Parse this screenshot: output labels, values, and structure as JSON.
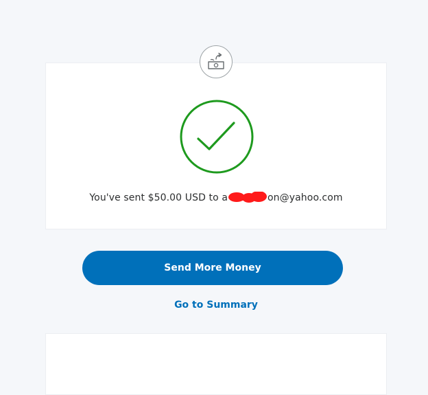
{
  "icons": {
    "badge": "money-send-icon",
    "status": "success-check-icon"
  },
  "colors": {
    "page_background": "#f5f7fa",
    "primary": "#0070ba",
    "success": "#1e9a1e",
    "redaction": "#ff1a1a"
  },
  "confirmation": {
    "message_prefix": "You've sent $50.00 USD to a",
    "message_suffix": "on@yahoo.com"
  },
  "actions": {
    "send_more_label": "Send More Money",
    "summary_label": "Go to Summary"
  }
}
